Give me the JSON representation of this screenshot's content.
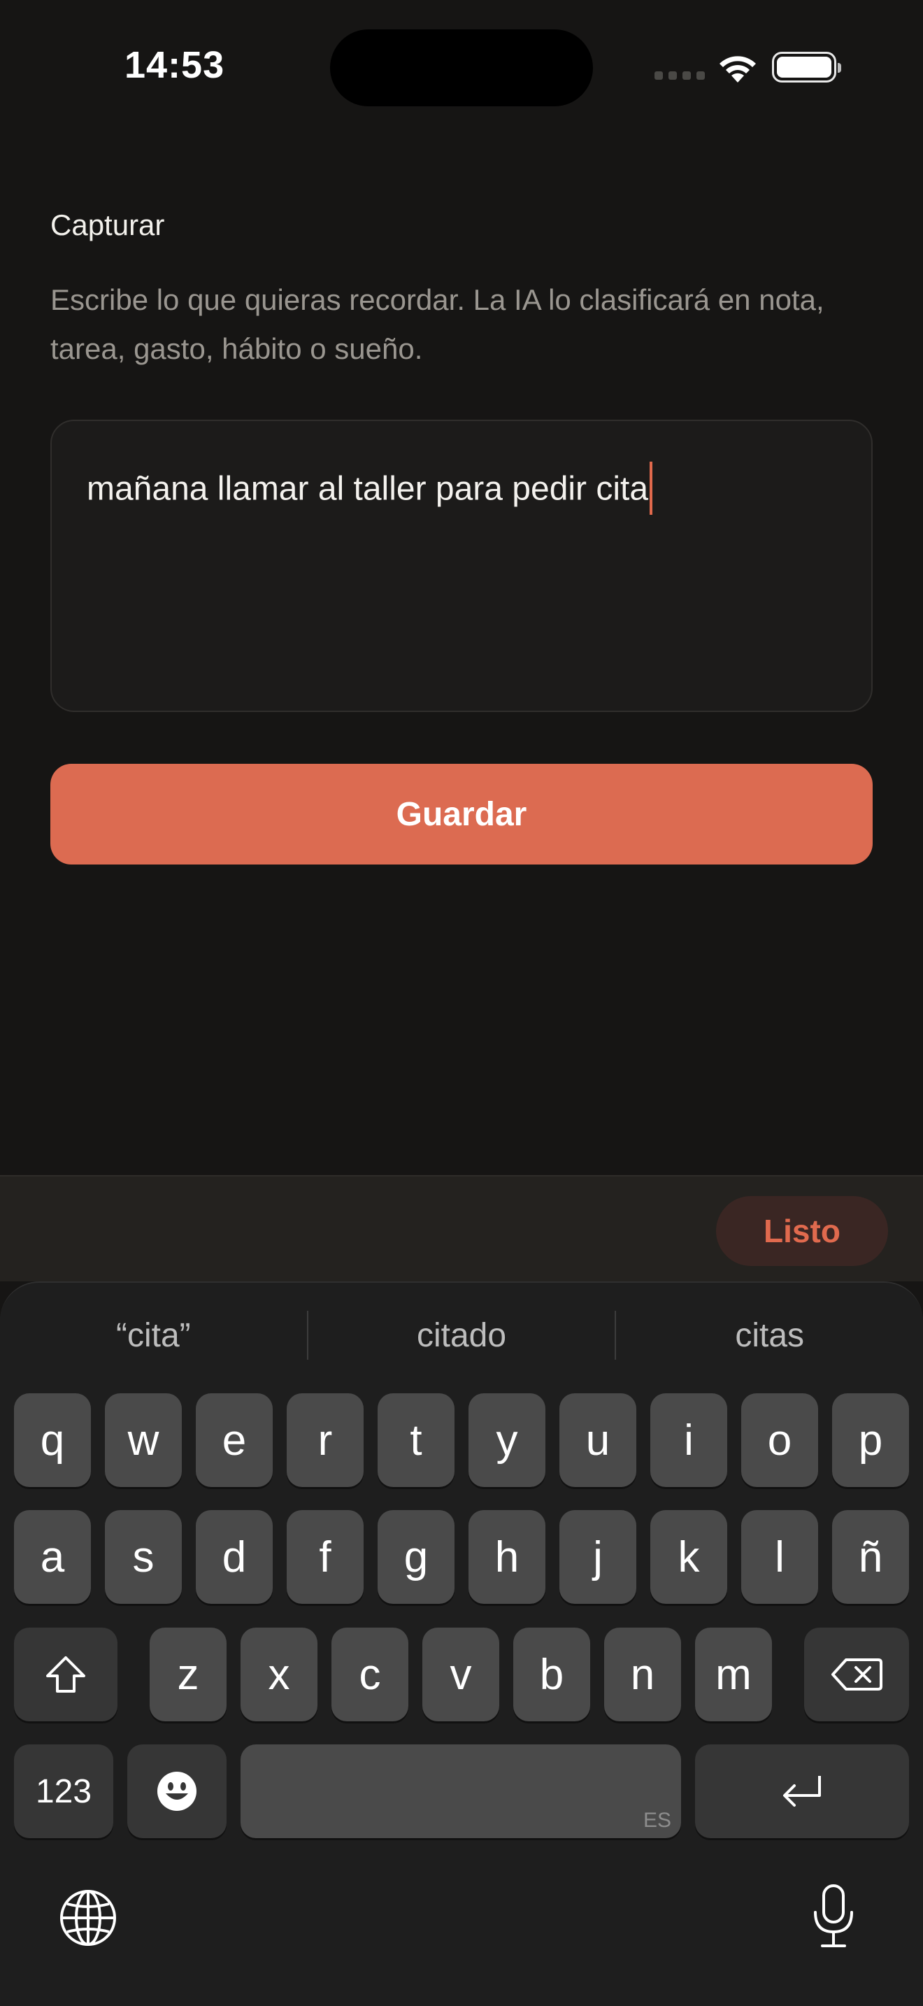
{
  "status_bar": {
    "time": "14:53",
    "icons": [
      "cellular-signal-icon",
      "wifi-icon",
      "battery-icon"
    ]
  },
  "capture": {
    "title": "Capturar",
    "description": "Escribe lo que quieras recordar. La IA lo clasificará en nota, tarea, gasto, hábito o sueño.",
    "input_value": "mañana llamar al taller para pedir cita",
    "save_label": "Guardar"
  },
  "accessory": {
    "done_label": "Listo"
  },
  "keyboard": {
    "suggestions": [
      "“cita”",
      "citado",
      "citas"
    ],
    "row1": [
      "q",
      "w",
      "e",
      "r",
      "t",
      "y",
      "u",
      "i",
      "o",
      "p"
    ],
    "row2": [
      "a",
      "s",
      "d",
      "f",
      "g",
      "h",
      "j",
      "k",
      "l",
      "ñ"
    ],
    "row3": [
      "z",
      "x",
      "c",
      "v",
      "b",
      "n",
      "m"
    ],
    "numbers_label": "123",
    "space_language": "ES",
    "icons": [
      "shift-icon",
      "delete-icon",
      "emoji-icon",
      "return-icon",
      "globe-icon",
      "microphone-icon"
    ]
  },
  "colors": {
    "background": "#161514",
    "accent": "#dc6b51",
    "accent_text": "#e06a4e",
    "keyboard_key": "#4a4a4a"
  }
}
